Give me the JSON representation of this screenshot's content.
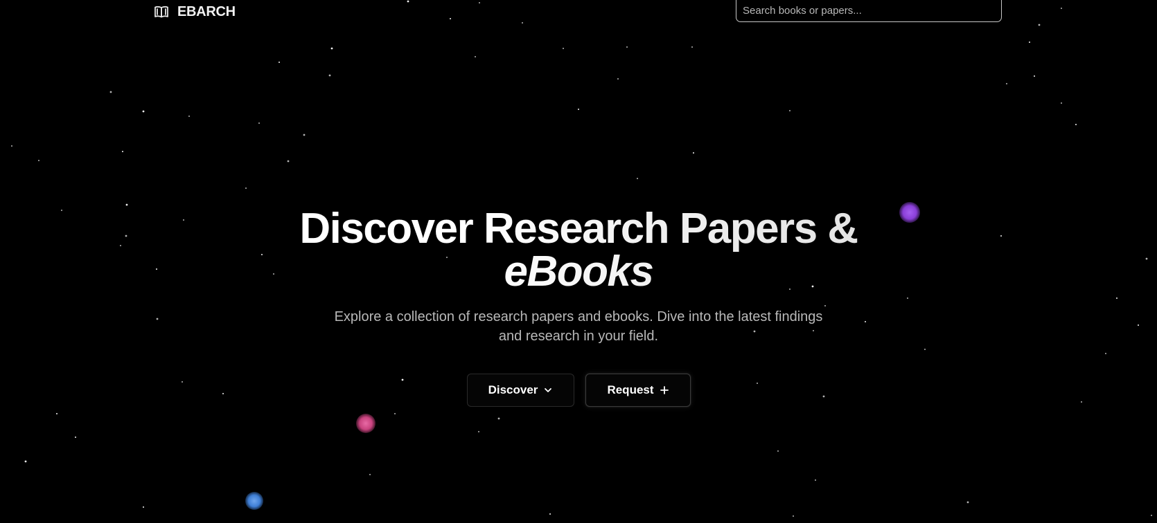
{
  "header": {
    "brand_icon": "open-book-icon",
    "brand_name": "EBARCH",
    "search_placeholder": "Search books or papers..."
  },
  "hero": {
    "title_line1": "Discover Research Papers &",
    "title_line2": "eBooks",
    "subtitle": "Explore a collection of research papers and ebooks. Dive into the latest findings and research in your field."
  },
  "actions": {
    "discover_label": "Discover",
    "discover_icon": "chevron-down-icon",
    "request_label": "Request",
    "request_icon": "plus-icon"
  },
  "colors": {
    "background": "#000000",
    "text_primary": "#ffffff",
    "text_muted": "#b9b9b9",
    "orb_purple": "#8a3fd8",
    "orb_pink": "#c8427e",
    "orb_blue": "#3f7fd6"
  }
}
